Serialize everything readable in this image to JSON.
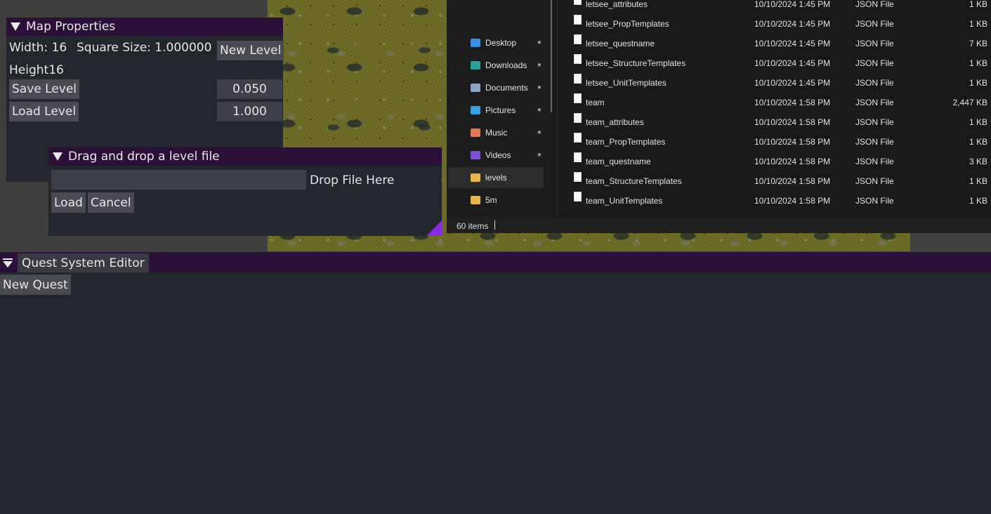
{
  "map_properties": {
    "title": "Map Properties",
    "width_label": "Width: 16",
    "square_size_label": "Square Size: 1.000000",
    "height_label": "Height16",
    "new_level_label": "New Level",
    "save_level_label": "Save Level",
    "load_level_label": "Load Level",
    "field1_value": "0.050",
    "field2_value": "1.000"
  },
  "drag_drop": {
    "title": "Drag and drop a level file",
    "input_value": "",
    "drop_label": "Drop File Here",
    "load_label": "Load",
    "cancel_label": "Cancel"
  },
  "explorer": {
    "nav_items": [
      {
        "label": "Desktop",
        "icon": "desktop-icon",
        "color": "#3a8ee6",
        "pinned": true
      },
      {
        "label": "Downloads",
        "icon": "download-icon",
        "color": "#2aa198",
        "pinned": true
      },
      {
        "label": "Documents",
        "icon": "document-icon",
        "color": "#8aa4c8",
        "pinned": true
      },
      {
        "label": "Pictures",
        "icon": "picture-icon",
        "color": "#3aa0e0",
        "pinned": true
      },
      {
        "label": "Music",
        "icon": "music-icon",
        "color": "#e07a5a",
        "pinned": true
      },
      {
        "label": "Videos",
        "icon": "video-icon",
        "color": "#7b4fd6",
        "pinned": true
      },
      {
        "label": "levels",
        "icon": "folder-icon",
        "color": "#e8b84a",
        "pinned": false
      },
      {
        "label": "5m",
        "icon": "folder-icon",
        "color": "#e8b84a",
        "pinned": false
      }
    ],
    "files": [
      {
        "name": "letsee_attributes",
        "date": "10/10/2024 1:45 PM",
        "type": "JSON File",
        "size": "1 KB"
      },
      {
        "name": "letsee_PropTemplates",
        "date": "10/10/2024 1:45 PM",
        "type": "JSON File",
        "size": "1 KB"
      },
      {
        "name": "letsee_questname",
        "date": "10/10/2024 1:45 PM",
        "type": "JSON File",
        "size": "7 KB"
      },
      {
        "name": "letsee_StructureTemplates",
        "date": "10/10/2024 1:45 PM",
        "type": "JSON File",
        "size": "1 KB"
      },
      {
        "name": "letsee_UnitTemplates",
        "date": "10/10/2024 1:45 PM",
        "type": "JSON File",
        "size": "1 KB"
      },
      {
        "name": "team",
        "date": "10/10/2024 1:58 PM",
        "type": "JSON File",
        "size": "2,447 KB"
      },
      {
        "name": "team_attributes",
        "date": "10/10/2024 1:58 PM",
        "type": "JSON File",
        "size": "1 KB"
      },
      {
        "name": "team_PropTemplates",
        "date": "10/10/2024 1:58 PM",
        "type": "JSON File",
        "size": "1 KB"
      },
      {
        "name": "team_questname",
        "date": "10/10/2024 1:58 PM",
        "type": "JSON File",
        "size": "3 KB"
      },
      {
        "name": "team_StructureTemplates",
        "date": "10/10/2024 1:58 PM",
        "type": "JSON File",
        "size": "1 KB"
      },
      {
        "name": "team_UnitTemplates",
        "date": "10/10/2024 1:58 PM",
        "type": "JSON File",
        "size": "1 KB"
      }
    ],
    "item_count": "60 items"
  },
  "quest_editor": {
    "title": "Quest System Editor",
    "new_quest_label": "New Quest"
  }
}
